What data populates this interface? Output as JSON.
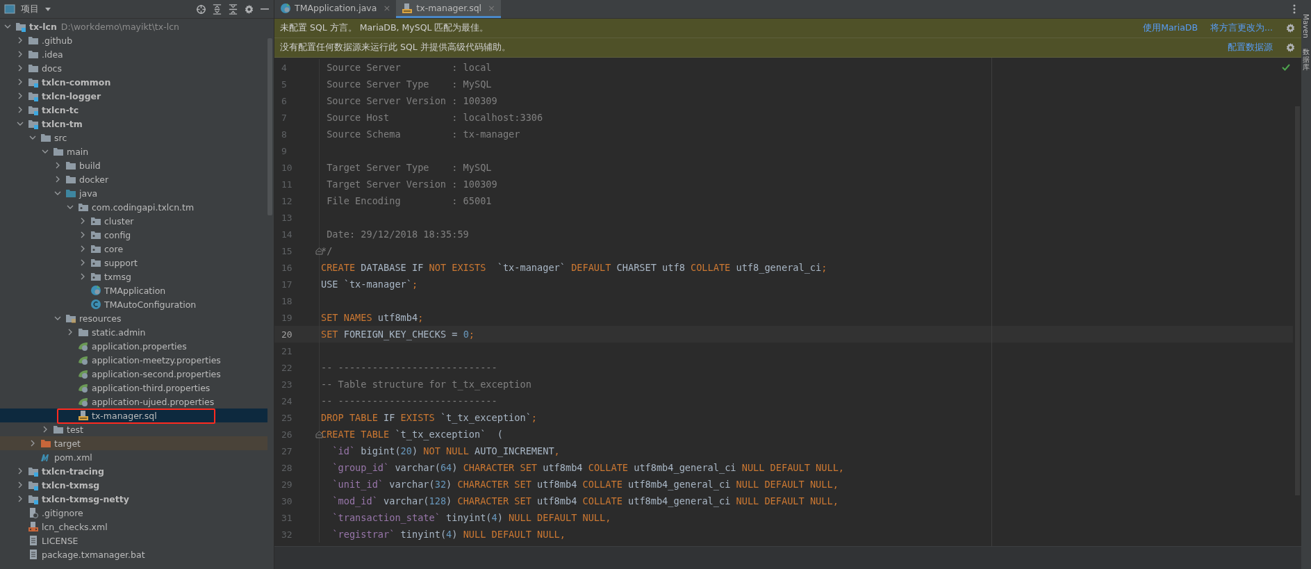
{
  "project_panel": {
    "title": "项目",
    "tree": [
      {
        "name": "tx-lcn",
        "path": "D:\\workdemo\\mayikt\\tx-lcn",
        "kind": "module",
        "expanded": true,
        "selected": false,
        "children": [
          {
            "name": ".github",
            "kind": "folder",
            "expanded": false,
            "selected": false
          },
          {
            "name": ".idea",
            "kind": "folder",
            "expanded": false,
            "selected": false
          },
          {
            "name": "docs",
            "kind": "folder",
            "expanded": false,
            "selected": false
          },
          {
            "name": "txlcn-common",
            "kind": "module",
            "expanded": false,
            "selected": false
          },
          {
            "name": "txlcn-logger",
            "kind": "module",
            "expanded": false,
            "selected": false
          },
          {
            "name": "txlcn-tc",
            "kind": "module",
            "expanded": false,
            "selected": false
          },
          {
            "name": "txlcn-tm",
            "kind": "module",
            "expanded": true,
            "selected": false,
            "children": [
              {
                "name": "src",
                "kind": "folder",
                "expanded": true,
                "selected": false,
                "children": [
                  {
                    "name": "main",
                    "kind": "folder",
                    "expanded": true,
                    "selected": false,
                    "children": [
                      {
                        "name": "build",
                        "kind": "folder",
                        "expanded": false,
                        "selected": false
                      },
                      {
                        "name": "docker",
                        "kind": "folder",
                        "expanded": false,
                        "selected": false
                      },
                      {
                        "name": "java",
                        "kind": "source-folder",
                        "expanded": true,
                        "selected": false,
                        "children": [
                          {
                            "name": "com.codingapi.txlcn.tm",
                            "kind": "package",
                            "expanded": true,
                            "selected": false,
                            "children": [
                              {
                                "name": "cluster",
                                "kind": "package",
                                "expanded": false,
                                "selected": false
                              },
                              {
                                "name": "config",
                                "kind": "package",
                                "expanded": false,
                                "selected": false
                              },
                              {
                                "name": "core",
                                "kind": "package",
                                "expanded": false,
                                "selected": false
                              },
                              {
                                "name": "support",
                                "kind": "package",
                                "expanded": false,
                                "selected": false
                              },
                              {
                                "name": "txmsg",
                                "kind": "package",
                                "expanded": false,
                                "selected": false
                              },
                              {
                                "name": "TMApplication",
                                "kind": "app-class",
                                "selected": false
                              },
                              {
                                "name": "TMAutoConfiguration",
                                "kind": "class",
                                "selected": false
                              }
                            ]
                          }
                        ]
                      },
                      {
                        "name": "resources",
                        "kind": "resources",
                        "expanded": true,
                        "selected": false,
                        "children": [
                          {
                            "name": "static.admin",
                            "kind": "folder",
                            "expanded": false,
                            "selected": false
                          },
                          {
                            "name": "application.properties",
                            "kind": "spring",
                            "selected": false
                          },
                          {
                            "name": "application-meetzy.properties",
                            "kind": "spring",
                            "selected": false
                          },
                          {
                            "name": "application-second.properties",
                            "kind": "spring",
                            "selected": false
                          },
                          {
                            "name": "application-third.properties",
                            "kind": "spring",
                            "selected": false
                          },
                          {
                            "name": "application-ujued.properties",
                            "kind": "spring",
                            "selected": false
                          },
                          {
                            "name": "tx-manager.sql",
                            "kind": "sql",
                            "selected": true
                          }
                        ]
                      }
                    ]
                  },
                  {
                    "name": "test",
                    "kind": "folder",
                    "expanded": false,
                    "selected": false
                  }
                ]
              },
              {
                "name": "target",
                "kind": "excluded-folder",
                "expanded": false,
                "selected": false
              },
              {
                "name": "pom.xml",
                "kind": "maven",
                "selected": false
              }
            ]
          },
          {
            "name": "txlcn-tracing",
            "kind": "module",
            "expanded": false,
            "selected": false
          },
          {
            "name": "txlcn-txmsg",
            "kind": "module",
            "expanded": false,
            "selected": false
          },
          {
            "name": "txlcn-txmsg-netty",
            "kind": "module",
            "expanded": false,
            "selected": false
          },
          {
            "name": ".gitignore",
            "kind": "gitignore",
            "selected": false
          },
          {
            "name": "lcn_checks.xml",
            "kind": "xml",
            "selected": false
          },
          {
            "name": "LICENSE",
            "kind": "text",
            "selected": false
          },
          {
            "name": "package.txmanager.bat",
            "kind": "text",
            "selected": false
          }
        ]
      }
    ]
  },
  "editor": {
    "tabs": [
      {
        "label": "TMApplication.java",
        "kind": "app-class",
        "close": "×",
        "selected": false
      },
      {
        "label": "tx-manager.sql",
        "kind": "sql",
        "close": "×",
        "selected": true
      }
    ],
    "banners": [
      {
        "text": "未配置 SQL 方言。 MariaDB, MySQL 匹配为最佳。",
        "links": [
          "使用MariaDB",
          "将方言更改为..."
        ]
      },
      {
        "text": "没有配置任何数据源来运行此 SQL 并提供高级代码辅助。",
        "links": [
          "配置数据源"
        ]
      }
    ],
    "lines": [
      {
        "number": "4",
        "current": false,
        "tokens": [
          {
            "kind": "comment",
            "text": " Source Server         : local"
          }
        ]
      },
      {
        "number": "5",
        "current": false,
        "tokens": [
          {
            "kind": "comment",
            "text": " Source Server Type    : MySQL"
          }
        ]
      },
      {
        "number": "6",
        "current": false,
        "tokens": [
          {
            "kind": "comment",
            "text": " Source Server Version : 100309"
          }
        ]
      },
      {
        "number": "7",
        "current": false,
        "tokens": [
          {
            "kind": "comment",
            "text": " Source Host           : localhost:3306"
          }
        ]
      },
      {
        "number": "8",
        "current": false,
        "tokens": [
          {
            "kind": "comment",
            "text": " Source Schema         : tx-manager"
          }
        ]
      },
      {
        "number": "9",
        "current": false
      },
      {
        "number": "10",
        "current": false,
        "tokens": [
          {
            "kind": "comment",
            "text": " Target Server Type    : MySQL"
          }
        ]
      },
      {
        "number": "11",
        "current": false,
        "tokens": [
          {
            "kind": "comment",
            "text": " Target Server Version : 100309"
          }
        ]
      },
      {
        "number": "12",
        "current": false,
        "tokens": [
          {
            "kind": "comment",
            "text": " File Encoding         : 65001"
          }
        ]
      },
      {
        "number": "13",
        "current": false
      },
      {
        "number": "14",
        "current": false,
        "tokens": [
          {
            "kind": "comment",
            "text": " Date: 29/12/2018 18:35:59"
          }
        ]
      },
      {
        "number": "15",
        "current": false,
        "fold": true,
        "tokens": [
          {
            "kind": "comment",
            "text": "*/"
          }
        ]
      },
      {
        "number": "16",
        "current": false,
        "tokens": [
          {
            "kind": "keyword",
            "text": "CREATE"
          },
          {
            "kind": "plain",
            "text": " DATABASE IF "
          },
          {
            "kind": "keyword",
            "text": "NOT EXISTS"
          },
          {
            "kind": "plain",
            "text": "  `tx-manager` "
          },
          {
            "kind": "keyword",
            "text": "DEFAULT"
          },
          {
            "kind": "plain",
            "text": " CHARSET utf8 "
          },
          {
            "kind": "keyword",
            "text": "COLLATE"
          },
          {
            "kind": "plain",
            "text": " utf8_general_ci"
          },
          {
            "kind": "keyword",
            "text": ";"
          }
        ]
      },
      {
        "number": "17",
        "current": false,
        "tokens": [
          {
            "kind": "plain",
            "text": "USE `tx-manager`"
          },
          {
            "kind": "keyword",
            "text": ";"
          }
        ]
      },
      {
        "number": "18",
        "current": false
      },
      {
        "number": "19",
        "current": false,
        "tokens": [
          {
            "kind": "keyword",
            "text": "SET NAMES"
          },
          {
            "kind": "plain",
            "text": " utf8mb4"
          },
          {
            "kind": "keyword",
            "text": ";"
          }
        ]
      },
      {
        "number": "20",
        "current": true,
        "tokens": [
          {
            "kind": "keyword",
            "text": "SET"
          },
          {
            "kind": "plain",
            "text": " FOREIGN_KEY_CHECKS = "
          },
          {
            "kind": "number",
            "text": "0"
          },
          {
            "kind": "keyword",
            "text": ";"
          }
        ]
      },
      {
        "number": "21",
        "current": false
      },
      {
        "number": "22",
        "current": false,
        "tokens": [
          {
            "kind": "comment",
            "text": "-- ----------------------------"
          }
        ]
      },
      {
        "number": "23",
        "current": false,
        "tokens": [
          {
            "kind": "comment",
            "text": "-- Table structure for t_tx_exception"
          }
        ]
      },
      {
        "number": "24",
        "current": false,
        "tokens": [
          {
            "kind": "comment",
            "text": "-- ----------------------------"
          }
        ]
      },
      {
        "number": "25",
        "current": false,
        "tokens": [
          {
            "kind": "keyword",
            "text": "DROP TABLE"
          },
          {
            "kind": "plain",
            "text": " IF "
          },
          {
            "kind": "keyword",
            "text": "EXISTS"
          },
          {
            "kind": "plain",
            "text": " `t_tx_exception`"
          },
          {
            "kind": "keyword",
            "text": ";"
          }
        ]
      },
      {
        "number": "26",
        "current": false,
        "fold": true,
        "tokens": [
          {
            "kind": "keyword",
            "text": "CREATE TABLE"
          },
          {
            "kind": "plain",
            "text": " `t_tx_exception`  ("
          }
        ]
      },
      {
        "number": "27",
        "current": false,
        "tokens": [
          {
            "kind": "field",
            "text": "  `id`"
          },
          {
            "kind": "plain",
            "text": " bigint("
          },
          {
            "kind": "number",
            "text": "20"
          },
          {
            "kind": "plain",
            "text": ") "
          },
          {
            "kind": "keyword",
            "text": "NOT NULL"
          },
          {
            "kind": "plain",
            "text": " AUTO_INCREMENT"
          },
          {
            "kind": "keyword",
            "text": ","
          }
        ]
      },
      {
        "number": "28",
        "current": false,
        "tokens": [
          {
            "kind": "field",
            "text": "  `group_id`"
          },
          {
            "kind": "plain",
            "text": " varchar("
          },
          {
            "kind": "number",
            "text": "64"
          },
          {
            "kind": "plain",
            "text": ") "
          },
          {
            "kind": "keyword",
            "text": "CHARACTER SET"
          },
          {
            "kind": "plain",
            "text": " utf8mb4 "
          },
          {
            "kind": "keyword",
            "text": "COLLATE"
          },
          {
            "kind": "plain",
            "text": " utf8mb4_general_ci "
          },
          {
            "kind": "keyword",
            "text": "NULL DEFAULT NULL,"
          }
        ]
      },
      {
        "number": "29",
        "current": false,
        "tokens": [
          {
            "kind": "field",
            "text": "  `unit_id`"
          },
          {
            "kind": "plain",
            "text": " varchar("
          },
          {
            "kind": "number",
            "text": "32"
          },
          {
            "kind": "plain",
            "text": ") "
          },
          {
            "kind": "keyword",
            "text": "CHARACTER SET"
          },
          {
            "kind": "plain",
            "text": " utf8mb4 "
          },
          {
            "kind": "keyword",
            "text": "COLLATE"
          },
          {
            "kind": "plain",
            "text": " utf8mb4_general_ci "
          },
          {
            "kind": "keyword",
            "text": "NULL DEFAULT NULL,"
          }
        ]
      },
      {
        "number": "30",
        "current": false,
        "tokens": [
          {
            "kind": "field",
            "text": "  `mod_id`"
          },
          {
            "kind": "plain",
            "text": " varchar("
          },
          {
            "kind": "number",
            "text": "128"
          },
          {
            "kind": "plain",
            "text": ") "
          },
          {
            "kind": "keyword",
            "text": "CHARACTER SET"
          },
          {
            "kind": "plain",
            "text": " utf8mb4 "
          },
          {
            "kind": "keyword",
            "text": "COLLATE"
          },
          {
            "kind": "plain",
            "text": " utf8mb4_general_ci "
          },
          {
            "kind": "keyword",
            "text": "NULL DEFAULT NULL,"
          }
        ]
      },
      {
        "number": "31",
        "current": false,
        "tokens": [
          {
            "kind": "field",
            "text": "  `transaction_state`"
          },
          {
            "kind": "plain",
            "text": " tinyint("
          },
          {
            "kind": "number",
            "text": "4"
          },
          {
            "kind": "plain",
            "text": ") "
          },
          {
            "kind": "keyword",
            "text": "NULL DEFAULT NULL,"
          }
        ]
      },
      {
        "number": "32",
        "current": false,
        "tokens": [
          {
            "kind": "field",
            "text": "  `registrar`"
          },
          {
            "kind": "plain",
            "text": " tinyint("
          },
          {
            "kind": "number",
            "text": "4"
          },
          {
            "kind": "plain",
            "text": ") "
          },
          {
            "kind": "keyword",
            "text": "NULL DEFAULT NULL,"
          }
        ]
      }
    ]
  },
  "side_strip": [
    "Maven",
    "数据库"
  ]
}
